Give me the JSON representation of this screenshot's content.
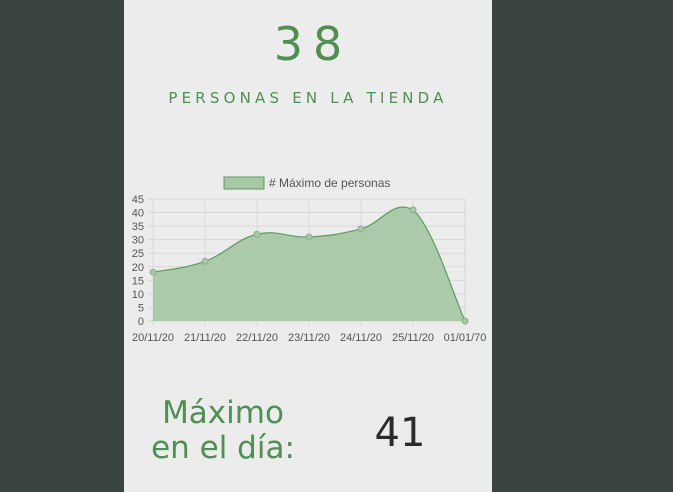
{
  "counter": {
    "value": "38",
    "label": "PERSONAS EN LA TIENDA"
  },
  "chart_data": {
    "type": "area",
    "categories": [
      "20/11/20",
      "21/11/20",
      "22/11/20",
      "23/11/20",
      "24/11/20",
      "25/11/20",
      "01/01/70"
    ],
    "series": [
      {
        "name": "# Máximo de personas",
        "values": [
          18,
          22,
          32,
          31,
          34,
          41,
          0
        ]
      }
    ],
    "ylim": [
      0,
      45
    ],
    "yticks": [
      0,
      5,
      10,
      15,
      20,
      25,
      30,
      35,
      40,
      45
    ],
    "legend_position": "top",
    "grid": true,
    "colors": {
      "fill": "#a8c8a6",
      "stroke": "#5e9a60",
      "grid": "#d8d8d8"
    }
  },
  "daily_max": {
    "label": "Máximo en el día:",
    "value": "41"
  },
  "colors": {
    "accent": "#4f8f52",
    "background": "#3a4540",
    "panel": "#ececec"
  }
}
